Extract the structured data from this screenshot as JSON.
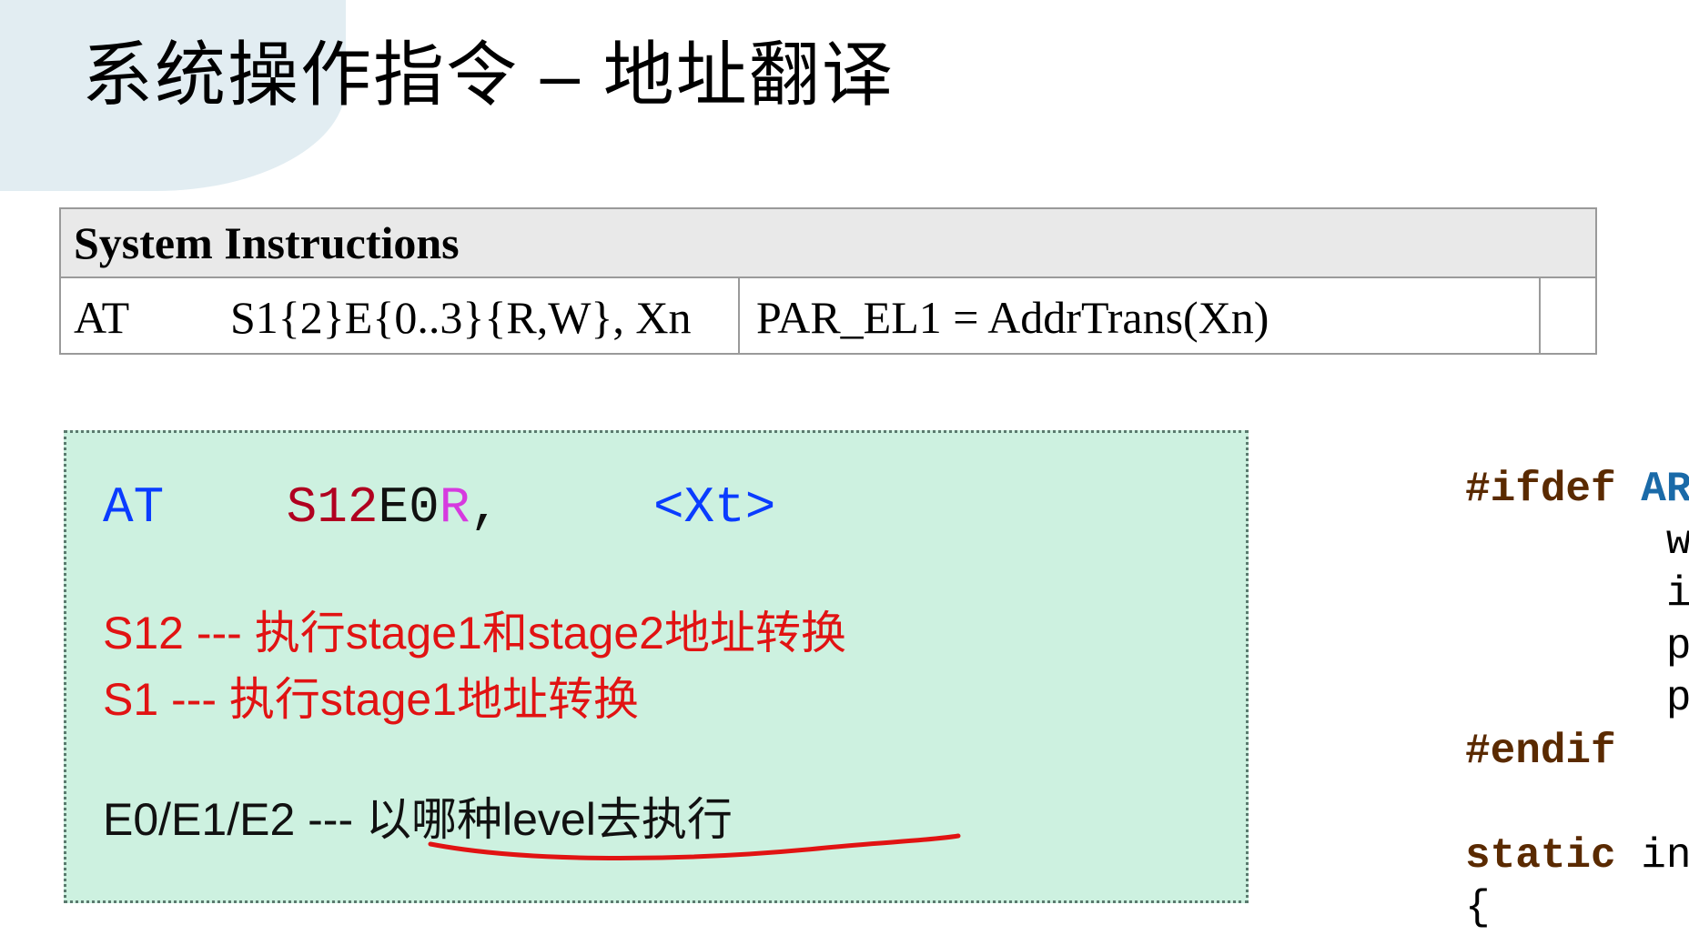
{
  "title": "系统操作指令 – 地址翻译",
  "table": {
    "header": "System Instructions",
    "row": {
      "mnemonic": "AT",
      "operands": "S1{2}E{0..3}{R,W}, Xn",
      "effect": "PAR_EL1 = AddrTrans(Xn)"
    }
  },
  "syntax": {
    "at": "AT",
    "s12": "S12",
    "e0": "E0",
    "r": "R",
    "comma": ",",
    "xt": "<Xt>"
  },
  "notes": {
    "s12": "S12 --- 执行stage1和stage2地址转换",
    "s1": "S1 --- 执行stage1地址转换",
    "ex": "E0/E1/E2 --- 以哪种level去执行"
  },
  "code": {
    "l1a": "#ifdef",
    "l1b": " AR",
    "l2": "        w",
    "l3": "        i",
    "l4": "        p",
    "l5": "        p",
    "l6": "#endif",
    "l7": "",
    "l8a": "static",
    "l8b": " in",
    "l9": "{"
  }
}
